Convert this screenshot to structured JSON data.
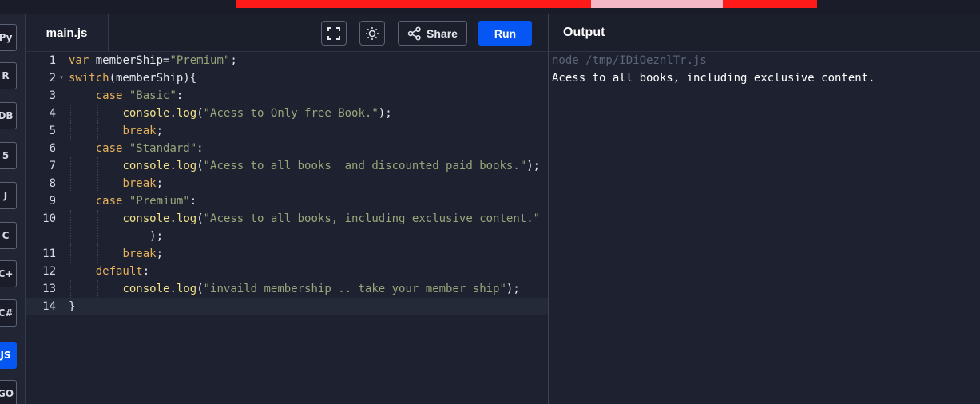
{
  "languages": [
    {
      "name": "python",
      "label": "Py"
    },
    {
      "name": "r",
      "label": "R"
    },
    {
      "name": "sql",
      "label": "DB"
    },
    {
      "name": "html",
      "label": "5"
    },
    {
      "name": "java",
      "label": "J"
    },
    {
      "name": "c",
      "label": "C"
    },
    {
      "name": "cpp",
      "label": "C+"
    },
    {
      "name": "csharp",
      "label": "C#"
    },
    {
      "name": "javascript",
      "label": "JS",
      "active": true
    },
    {
      "name": "go",
      "label": "GO"
    }
  ],
  "editor": {
    "file_tab": "main.js",
    "share_label": "Share",
    "run_label": "Run",
    "lines": [
      {
        "num": "1",
        "fold": "",
        "text": "var memberShip=\"Premium\";"
      },
      {
        "num": "2",
        "fold": "▾",
        "text": "switch(memberShip){"
      },
      {
        "num": "3",
        "fold": "",
        "text": "    case \"Basic\":"
      },
      {
        "num": "4",
        "fold": "",
        "text": "        console.log(\"Acess to Only free Book.\");"
      },
      {
        "num": "5",
        "fold": "",
        "text": "        break;"
      },
      {
        "num": "6",
        "fold": "",
        "text": "    case \"Standard\":"
      },
      {
        "num": "7",
        "fold": "",
        "text": "        console.log(\"Acess to all books  and discounted paid books.\");"
      },
      {
        "num": "8",
        "fold": "",
        "text": "        break;"
      },
      {
        "num": "9",
        "fold": "",
        "text": "    case \"Premium\":"
      },
      {
        "num": "10",
        "fold": "",
        "text": "        console.log(\"Acess to all books, including exclusive content.\""
      },
      {
        "num": "",
        "fold": "",
        "text": "            );"
      },
      {
        "num": "11",
        "fold": "",
        "text": "        break;"
      },
      {
        "num": "12",
        "fold": "",
        "text": "    default:"
      },
      {
        "num": "13",
        "fold": "",
        "text": "        console.log(\"invaild membership .. take your member ship\");"
      },
      {
        "num": "14",
        "fold": "",
        "text": "}",
        "current": true
      }
    ]
  },
  "output": {
    "title": "Output",
    "command": "node /tmp/IDiOeznlTr.js",
    "result": "Acess to all books, including exclusive content."
  },
  "colors": {
    "accent": "#0556f3",
    "keyword": "#e6b15a",
    "function": "#f0e08a",
    "string": "#98a67a",
    "ad_banner": "#ff1a1a"
  }
}
